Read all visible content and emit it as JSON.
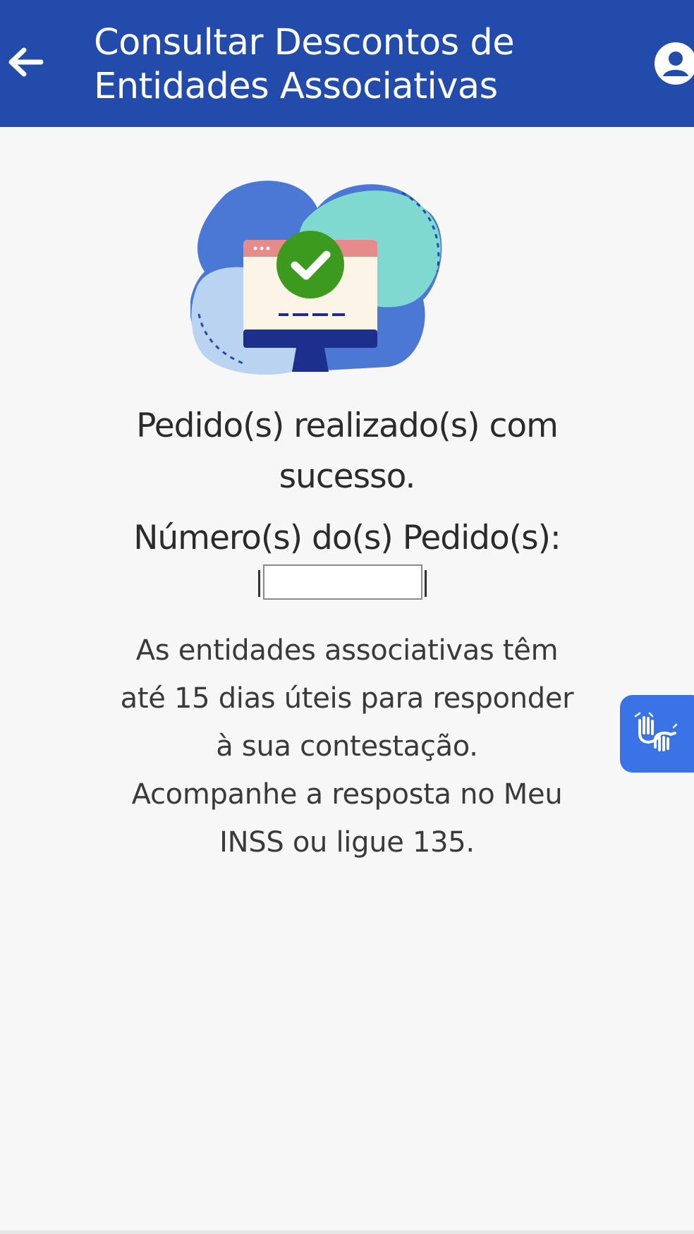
{
  "header": {
    "title_line1": "Consultar Descontos de",
    "title_line2": "Entidades Associativas"
  },
  "icons": {
    "back": "arrow-left-icon",
    "account": "user-circle-icon",
    "illustration": "monitor-checkmark-illustration",
    "libras": "sign-language-hands-icon"
  },
  "success": {
    "line1": "Pedido(s) realizado(s) com",
    "line2": "sucesso.",
    "order_label": "Número(s) do(s) Pedido(s):"
  },
  "info": {
    "line1": "As entidades associativas têm",
    "line2": "até 15 dias úteis para responder",
    "line3": "à sua contestação.",
    "line4": "Acompanhe a resposta no Meu",
    "line5": "INSS ou ligue 135."
  },
  "colors": {
    "header_bg": "#234bab",
    "page_bg": "#f7f7f7",
    "check_green": "#3c9a1f",
    "libras_button": "#3a73e6"
  }
}
